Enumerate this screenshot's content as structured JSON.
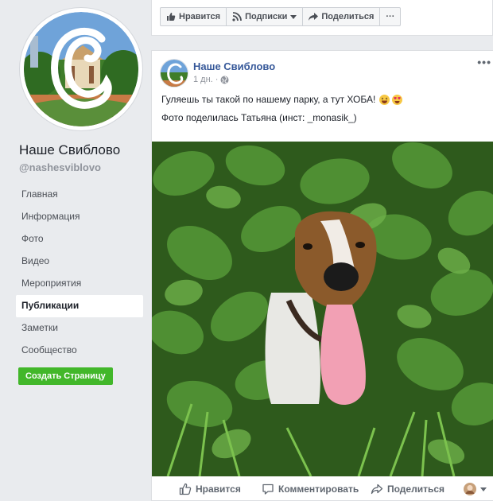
{
  "sidebar": {
    "page_name": "Наше Свиблово",
    "handle": "@nashesviblovo",
    "nav": [
      {
        "label": "Главная"
      },
      {
        "label": "Информация"
      },
      {
        "label": "Фото"
      },
      {
        "label": "Видео"
      },
      {
        "label": "Мероприятия"
      },
      {
        "label": "Публикации",
        "active": true
      },
      {
        "label": "Заметки"
      },
      {
        "label": "Сообщество"
      }
    ],
    "create_page_label": "Создать Страницу"
  },
  "top_buttons": {
    "like": "Нравится",
    "subscriptions": "Подписки",
    "share": "Поделиться",
    "more": "···"
  },
  "post": {
    "author": "Наше Свиблово",
    "time": "1 дн.",
    "more": "•••",
    "text_line1": "Гуляешь ты такой по нашему парку, а тут ХОБА!",
    "text_line2": "Фото поделилась Татьяна (инст: _monasik_)",
    "emojis": [
      "laughing-emoji",
      "heart-eyes-emoji"
    ],
    "image_description_icon": "dog-in-bushes-photo",
    "actions": {
      "like": "Нравится",
      "comment": "Комментировать",
      "share": "Поделиться"
    }
  },
  "colors": {
    "background": "#e9ebee",
    "link_blue": "#365899",
    "create_green": "#42b72a",
    "foliage": "#3f7d2a"
  }
}
